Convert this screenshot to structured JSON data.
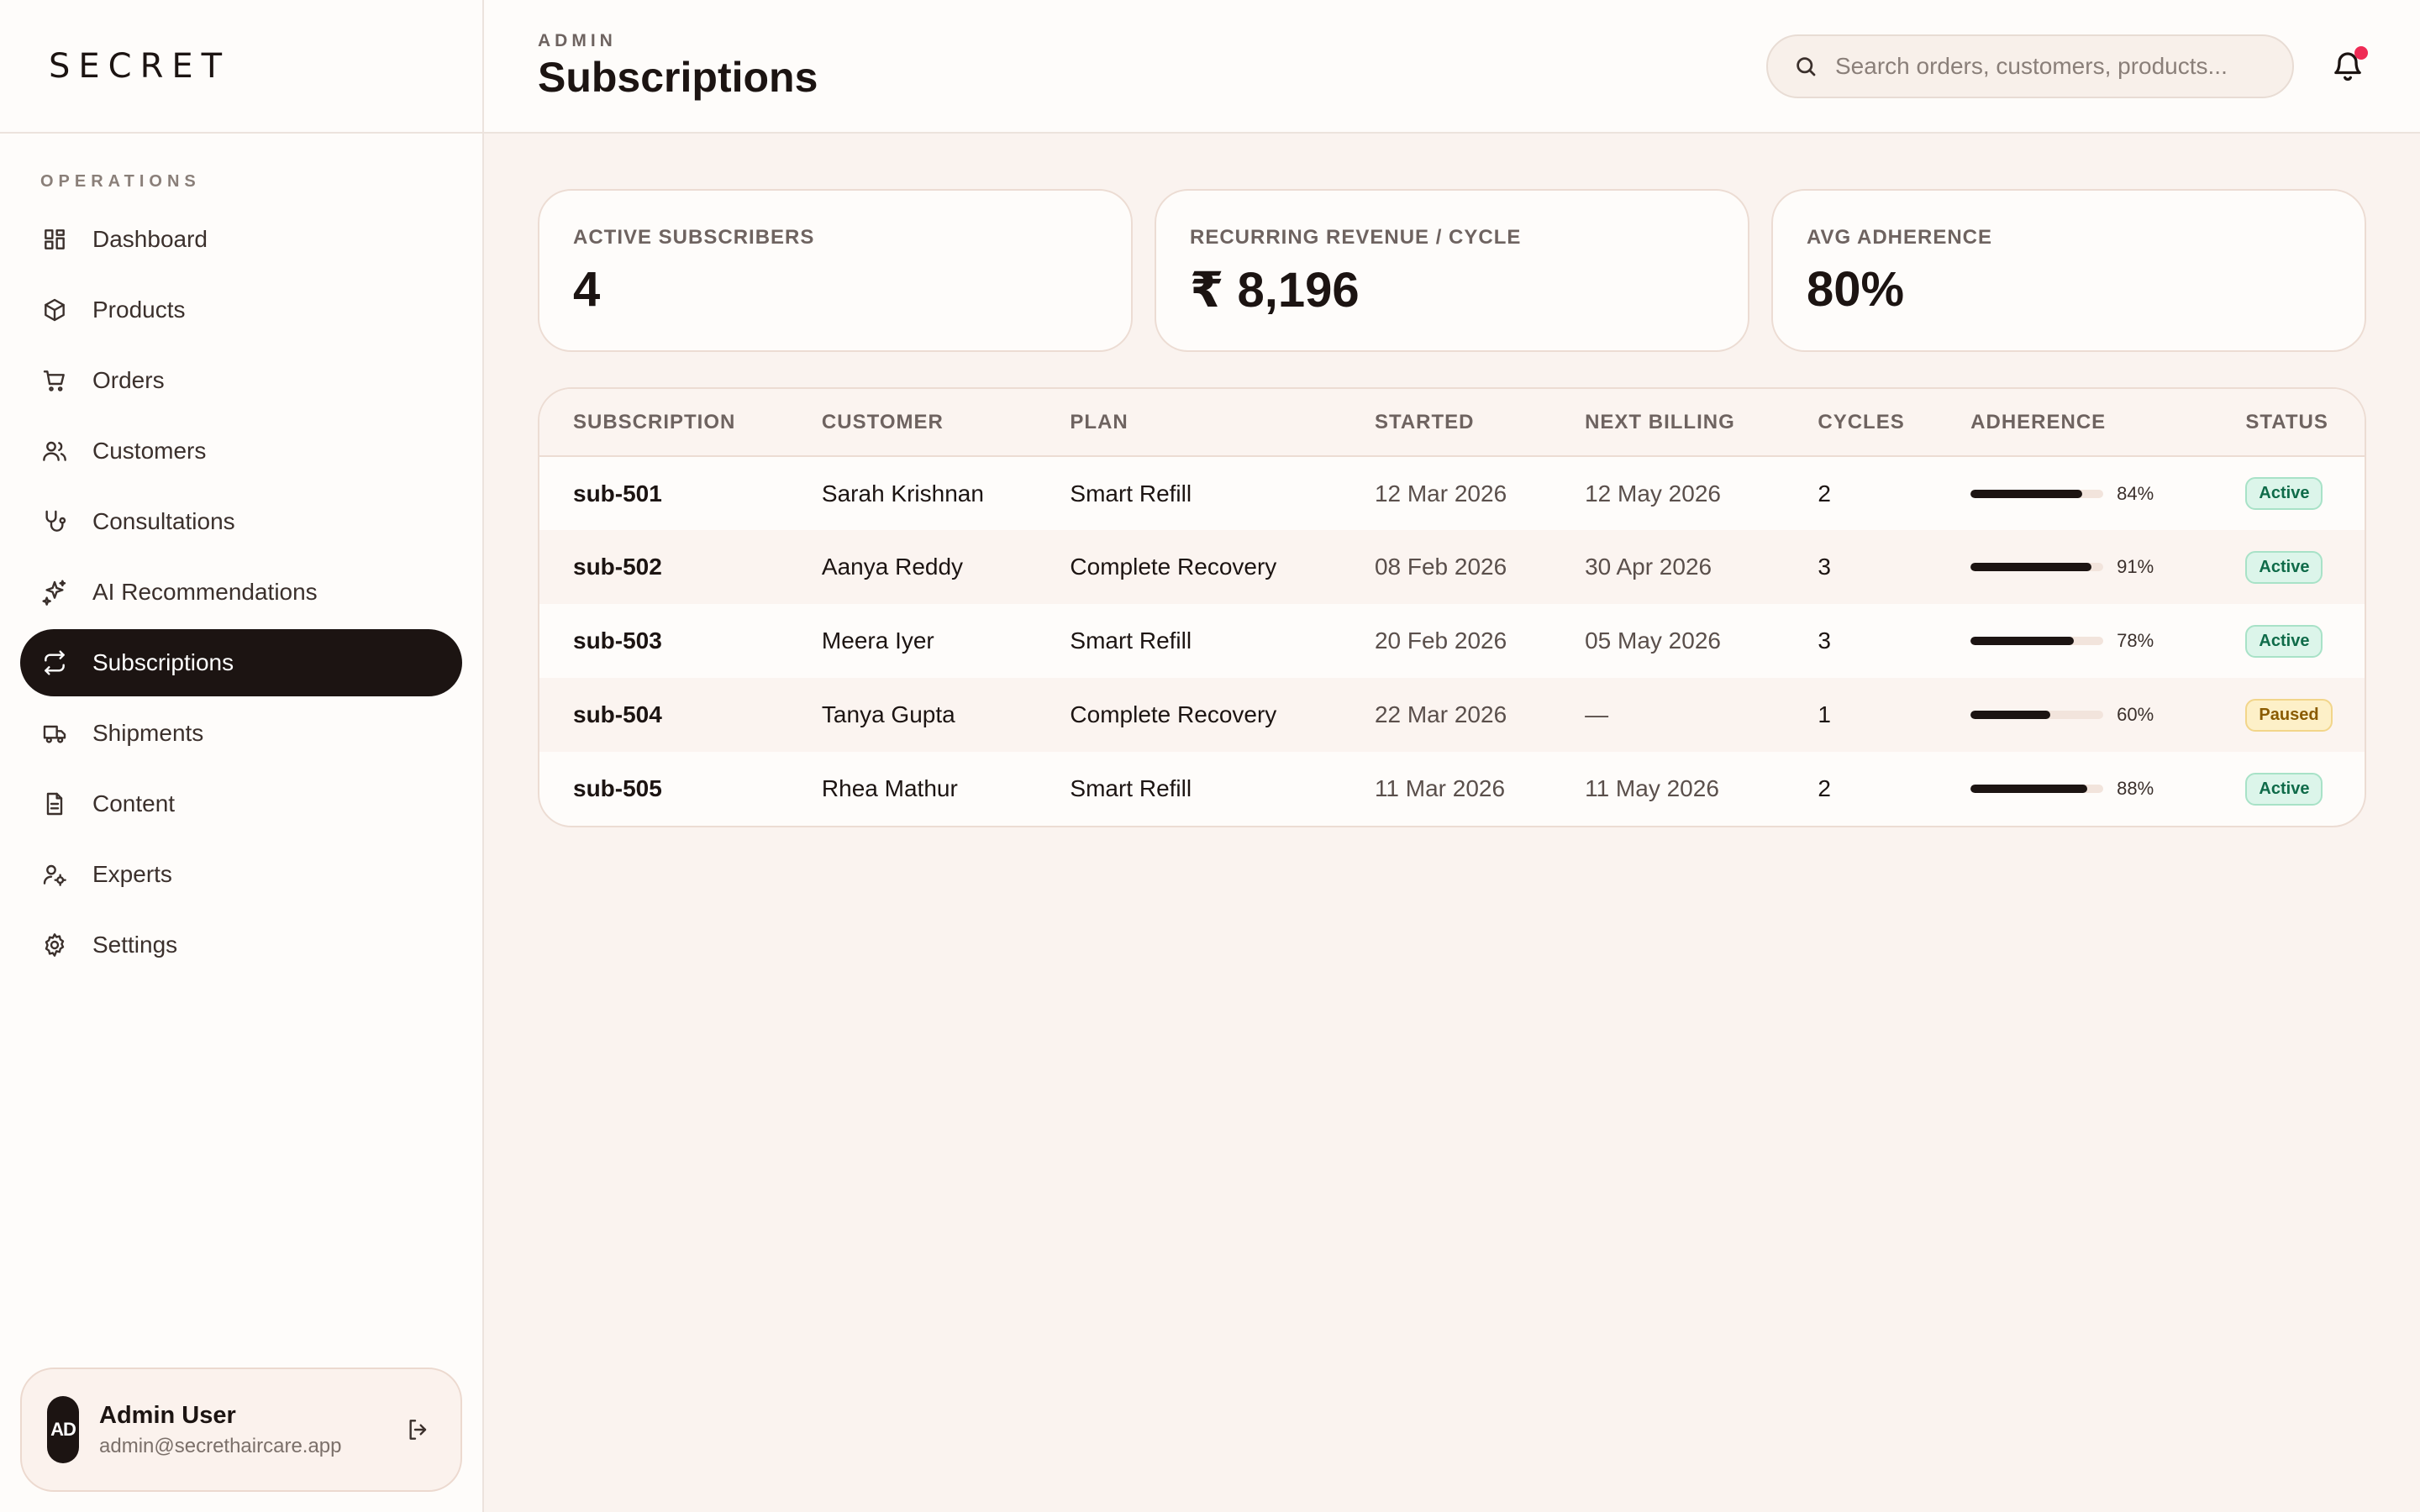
{
  "brand": {
    "logo": "SECRET"
  },
  "sidebar": {
    "section": "OPERATIONS",
    "items": [
      {
        "label": "Dashboard",
        "icon": "dashboard-icon"
      },
      {
        "label": "Products",
        "icon": "box-icon"
      },
      {
        "label": "Orders",
        "icon": "cart-icon"
      },
      {
        "label": "Customers",
        "icon": "users-icon"
      },
      {
        "label": "Consultations",
        "icon": "stethoscope-icon"
      },
      {
        "label": "AI Recommendations",
        "icon": "sparkles-icon"
      },
      {
        "label": "Subscriptions",
        "icon": "repeat-icon",
        "active": true
      },
      {
        "label": "Shipments",
        "icon": "truck-icon"
      },
      {
        "label": "Content",
        "icon": "document-icon"
      },
      {
        "label": "Experts",
        "icon": "user-gear-icon"
      },
      {
        "label": "Settings",
        "icon": "gear-icon"
      }
    ],
    "user": {
      "initials": "AD",
      "name": "Admin User",
      "email": "admin@secrethaircare.app"
    }
  },
  "header": {
    "eyebrow": "ADMIN",
    "title": "Subscriptions",
    "search_placeholder": "Search orders, customers, products..."
  },
  "stats": [
    {
      "label": "ACTIVE SUBSCRIBERS",
      "value": "4"
    },
    {
      "label": "RECURRING REVENUE / CYCLE",
      "value": "₹ 8,196"
    },
    {
      "label": "AVG ADHERENCE",
      "value": "80%"
    }
  ],
  "table": {
    "columns": [
      "SUBSCRIPTION",
      "CUSTOMER",
      "PLAN",
      "STARTED",
      "NEXT BILLING",
      "CYCLES",
      "ADHERENCE",
      "STATUS"
    ],
    "rows": [
      {
        "id": "sub-501",
        "customer": "Sarah Krishnan",
        "plan": "Smart Refill",
        "started": "12 Mar 2026",
        "next": "12 May 2026",
        "cycles": "2",
        "adherence": 84,
        "adherence_label": "84%",
        "status": "Active"
      },
      {
        "id": "sub-502",
        "customer": "Aanya Reddy",
        "plan": "Complete Recovery",
        "started": "08 Feb 2026",
        "next": "30 Apr 2026",
        "cycles": "3",
        "adherence": 91,
        "adherence_label": "91%",
        "status": "Active"
      },
      {
        "id": "sub-503",
        "customer": "Meera Iyer",
        "plan": "Smart Refill",
        "started": "20 Feb 2026",
        "next": "05 May 2026",
        "cycles": "3",
        "adherence": 78,
        "adherence_label": "78%",
        "status": "Active"
      },
      {
        "id": "sub-504",
        "customer": "Tanya Gupta",
        "plan": "Complete Recovery",
        "started": "22 Mar 2026",
        "next": "—",
        "cycles": "1",
        "adherence": 60,
        "adherence_label": "60%",
        "status": "Paused"
      },
      {
        "id": "sub-505",
        "customer": "Rhea Mathur",
        "plan": "Smart Refill",
        "started": "11 Mar 2026",
        "next": "11 May 2026",
        "cycles": "2",
        "adherence": 88,
        "adherence_label": "88%",
        "status": "Active"
      }
    ]
  }
}
